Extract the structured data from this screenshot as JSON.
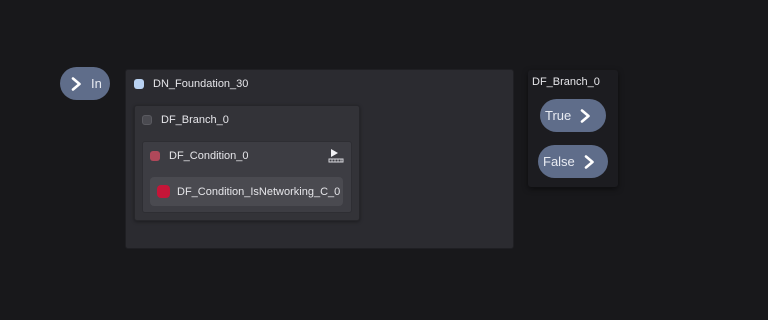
{
  "pin_in": {
    "label": "In",
    "icon": "chevron-right-icon"
  },
  "foundation": {
    "title": "DN_Foundation_30",
    "color": "#b9d2f2",
    "branch": {
      "title": "DF_Branch_0",
      "condition": {
        "title": "DF_Condition_0",
        "color": "#b0485a",
        "icon": "play-gavel-icon",
        "item": {
          "label": "DF_Condition_IsNetworking_C_0",
          "color": "#c51538"
        }
      }
    }
  },
  "branch_outputs": {
    "title": "DF_Branch_0",
    "outputs": [
      {
        "label": "True",
        "icon": "chevron-right-icon"
      },
      {
        "label": "False",
        "icon": "chevron-right-icon"
      }
    ]
  },
  "colors": {
    "canvas": "#18181b",
    "pin": "#5f6d8a"
  }
}
